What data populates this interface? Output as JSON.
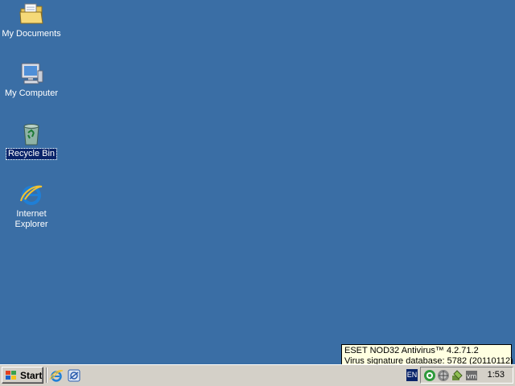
{
  "desktop": {
    "background": "#3a6ea5",
    "icons": [
      {
        "label": "My Documents",
        "icon": "folder-documents-icon"
      },
      {
        "label": "My Computer",
        "icon": "computer-icon"
      },
      {
        "label": "Recycle Bin",
        "icon": "recycle-bin-icon",
        "selected": true
      },
      {
        "label": "Internet\nExplorer",
        "icon": "internet-explorer-icon"
      }
    ]
  },
  "tooltip": {
    "line1": "ESET NOD32 Antivirus™ 4.2.71.2",
    "line2": "Virus signature database: 5782 (20110112)"
  },
  "taskbar": {
    "start_label": "Start",
    "quick_launch": [
      "internet-explorer-icon",
      "outlook-express-icon"
    ],
    "language": "EN",
    "tray_icons": [
      "eset-nod32-icon",
      "network-icon",
      "safely-remove-hardware-icon",
      "vmware-tools-icon"
    ],
    "clock": "1:53"
  }
}
